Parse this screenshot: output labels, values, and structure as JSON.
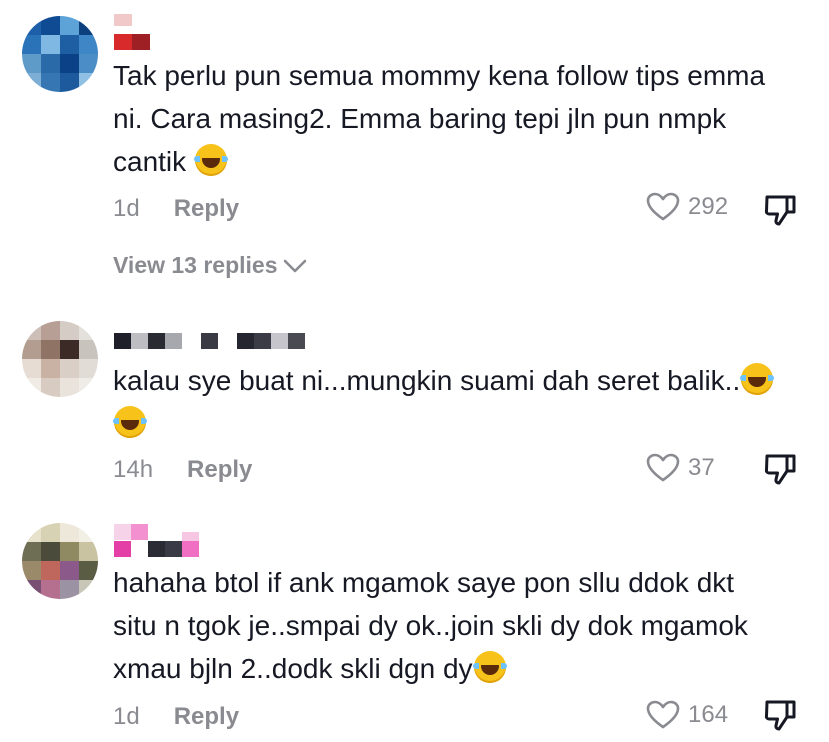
{
  "comments": [
    {
      "text": "Tak perlu pun semua mommy kena follow tips emma ni. Cara masing2. Emma baring tepi jln pun nmpk cantik",
      "emoji_count": 1,
      "time": "1d",
      "reply_label": "Reply",
      "likes": "292",
      "view_replies": "View 13 replies"
    },
    {
      "text": "kalau sye buat ni...mungkin suami dah seret balik..",
      "emoji_count": 2,
      "time": "14h",
      "reply_label": "Reply",
      "likes": "37"
    },
    {
      "text": "hahaha btol if ank mgamok saye pon sllu ddok dkt situ n tgok je..smpai dy ok..join skli dy dok mgamok xmau bjln 2..dodk skli dgn dy",
      "emoji_count": 1,
      "time": "1d",
      "reply_label": "Reply",
      "likes": "164"
    }
  ],
  "colors": {
    "text": "#161823",
    "secondary": "#8a8b91",
    "emoji": "#f7c21a"
  },
  "icons": [
    "heart-icon",
    "thumbs-down-icon",
    "chevron-down-icon",
    "laughing-emoji-icon"
  ]
}
